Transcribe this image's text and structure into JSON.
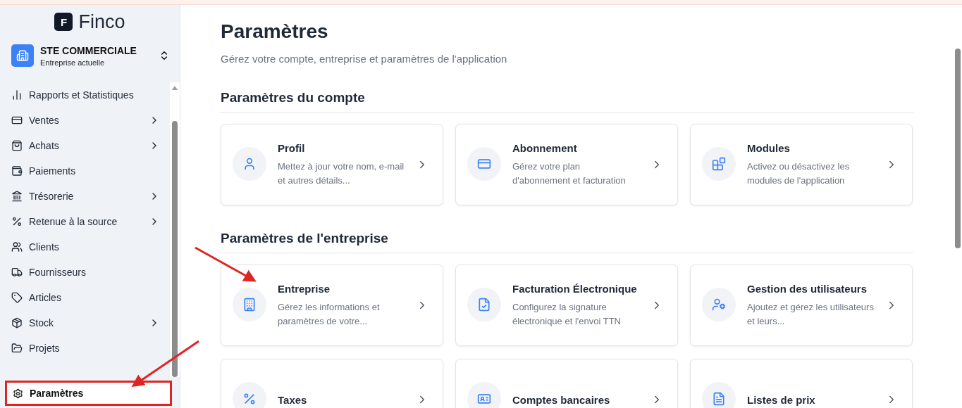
{
  "brand": {
    "name": "Finco",
    "mark": "F"
  },
  "company": {
    "name": "STE COMMERCIALE",
    "subtitle": "Entreprise actuelle"
  },
  "sidebar": {
    "items": [
      {
        "label": "Rapports et Statistiques",
        "submenu": false,
        "selected": false
      },
      {
        "label": "Ventes",
        "submenu": true,
        "selected": false
      },
      {
        "label": "Achats",
        "submenu": true,
        "selected": false
      },
      {
        "label": "Paiements",
        "submenu": false,
        "selected": false
      },
      {
        "label": "Trésorerie",
        "submenu": true,
        "selected": false
      },
      {
        "label": "Retenue à la source",
        "submenu": true,
        "selected": false
      },
      {
        "label": "Clients",
        "submenu": false,
        "selected": false
      },
      {
        "label": "Fournisseurs",
        "submenu": false,
        "selected": false
      },
      {
        "label": "Articles",
        "submenu": false,
        "selected": false
      },
      {
        "label": "Stock",
        "submenu": true,
        "selected": false
      },
      {
        "label": "Projets",
        "submenu": false,
        "selected": false
      }
    ],
    "footer_item": {
      "label": "Paramètres",
      "selected": true
    }
  },
  "page": {
    "title": "Paramètres",
    "subtitle": "Gérez votre compte, entreprise et paramètres de l'application"
  },
  "sections": [
    {
      "title": "Paramètres du compte",
      "cards": [
        {
          "title": "Profil",
          "description": "Mettez à jour votre nom, e-mail et autres détails..."
        },
        {
          "title": "Abonnement",
          "description": "Gérez votre plan d'abonnement et facturation"
        },
        {
          "title": "Modules",
          "description": "Activez ou désactivez les modules de l'application"
        }
      ]
    },
    {
      "title": "Paramètres de l'entreprise",
      "cards": [
        {
          "title": "Entreprise",
          "description": "Gérez les informations et paramètres de votre..."
        },
        {
          "title": "Facturation Électronique",
          "description": "Configurez la signature électronique et l'envoi TTN"
        },
        {
          "title": "Gestion des utilisateurs",
          "description": "Ajoutez et gérez les utilisateurs et leurs..."
        },
        {
          "title": "Taxes"
        },
        {
          "title": "Comptes bancaires"
        },
        {
          "title": "Listes de prix"
        }
      ]
    }
  ]
}
